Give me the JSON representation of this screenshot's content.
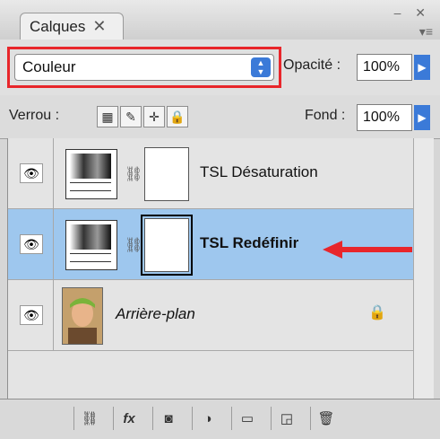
{
  "panel": {
    "tab_label": "Calques",
    "tab_close": "✕",
    "window_controls": "– ✕",
    "menu_icon": "▾≡"
  },
  "blend": {
    "mode": "Couleur",
    "opacity_label": "Opacité :",
    "opacity_value": "100%"
  },
  "lock": {
    "label": "Verrou :",
    "fill_label": "Fond :",
    "fill_value": "100%"
  },
  "layers": [
    {
      "name": "TSL Désaturation",
      "selected": false,
      "icon": "hue-saturation-adjustment-icon"
    },
    {
      "name": "TSL Redéfinir",
      "selected": true,
      "icon": "hue-saturation-adjustment-icon"
    },
    {
      "name": "Arrière-plan",
      "selected": false,
      "icon": "photo-thumbnail",
      "locked": true
    }
  ],
  "footer": {
    "buttons": [
      "link-layers",
      "fx",
      "add-mask",
      "new-adjustment",
      "new-group",
      "new-layer",
      "delete"
    ]
  },
  "colors": {
    "selected_row": "#9ec7ee",
    "highlight_red": "#e8262b",
    "accent_blue": "#3b7ad8"
  }
}
